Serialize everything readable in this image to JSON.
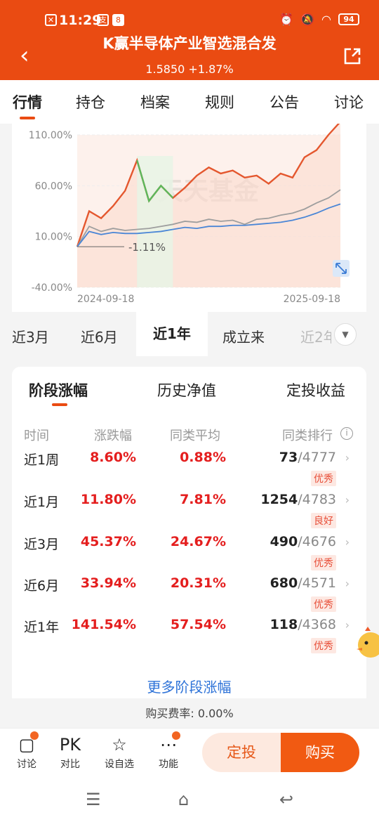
{
  "status": {
    "time": "11:29",
    "battery": "94"
  },
  "header": {
    "title": "K赢半导体产业智选混合发",
    "nav": "1.5850",
    "change": "+1.87%"
  },
  "tabs": [
    "行情",
    "持仓",
    "档案",
    "规则",
    "公告",
    "讨论"
  ],
  "chart_data": {
    "type": "line",
    "ylim": [
      -40,
      110
    ],
    "yticks": [
      "110.00%",
      "60.00%",
      "10.00%",
      "-40.00%"
    ],
    "x": [
      "2024-09-18",
      "2025-09-18"
    ],
    "annotation": "-1.11%",
    "watermark": "天天基金",
    "series": [
      {
        "values": [
          0,
          35,
          28,
          40,
          55,
          85,
          45,
          60,
          48,
          58,
          70,
          78,
          72,
          75,
          68,
          70,
          62,
          72,
          68,
          88,
          95,
          110,
          123
        ]
      },
      {
        "values": [
          0,
          20,
          15,
          18,
          16,
          17,
          18,
          20,
          22,
          25,
          24,
          27,
          25,
          26,
          22,
          27,
          28,
          31,
          33,
          37,
          43,
          48,
          56
        ]
      },
      {
        "values": [
          0,
          15,
          12,
          14,
          13,
          13,
          14,
          15,
          17,
          19,
          18,
          20,
          20,
          21,
          21,
          22,
          23,
          24,
          26,
          29,
          33,
          38,
          42
        ]
      }
    ]
  },
  "periods": [
    "近3月",
    "近6月",
    "近1年",
    "成立来",
    "近2年"
  ],
  "perf": {
    "tabs": [
      "阶段涨幅",
      "历史净值",
      "定投收益"
    ],
    "headers": [
      "时间",
      "涨跌幅",
      "同类平均",
      "同类排行"
    ],
    "rows": [
      {
        "period": "近1周",
        "change": "8.60%",
        "avg": "0.88%",
        "rank": "73",
        "total": "/4777",
        "badge": "优秀"
      },
      {
        "period": "近1月",
        "change": "11.80%",
        "avg": "7.81%",
        "rank": "1254",
        "total": "/4783",
        "badge": "良好"
      },
      {
        "period": "近3月",
        "change": "45.37%",
        "avg": "24.67%",
        "rank": "490",
        "total": "/4676",
        "badge": "优秀"
      },
      {
        "period": "近6月",
        "change": "33.94%",
        "avg": "20.31%",
        "rank": "680",
        "total": "/4571",
        "badge": "优秀"
      },
      {
        "period": "近1年",
        "change": "141.54%",
        "avg": "57.54%",
        "rank": "118",
        "total": "/4368",
        "badge": "优秀"
      }
    ],
    "more": "更多阶段涨幅",
    "fee": "购买费率: 0.00%"
  },
  "bottom": {
    "icons": [
      {
        "glyph": "💬",
        "label": "讨论"
      },
      {
        "glyph": "PK",
        "label": "对比"
      },
      {
        "glyph": "☆",
        "label": "设自选"
      },
      {
        "glyph": "⋯",
        "label": "功能"
      }
    ],
    "dingtou": "定投",
    "buy": "购买"
  },
  "colors": {
    "brand": "#ea4b12",
    "up": "#e41e1e",
    "link": "#2e73d8"
  }
}
